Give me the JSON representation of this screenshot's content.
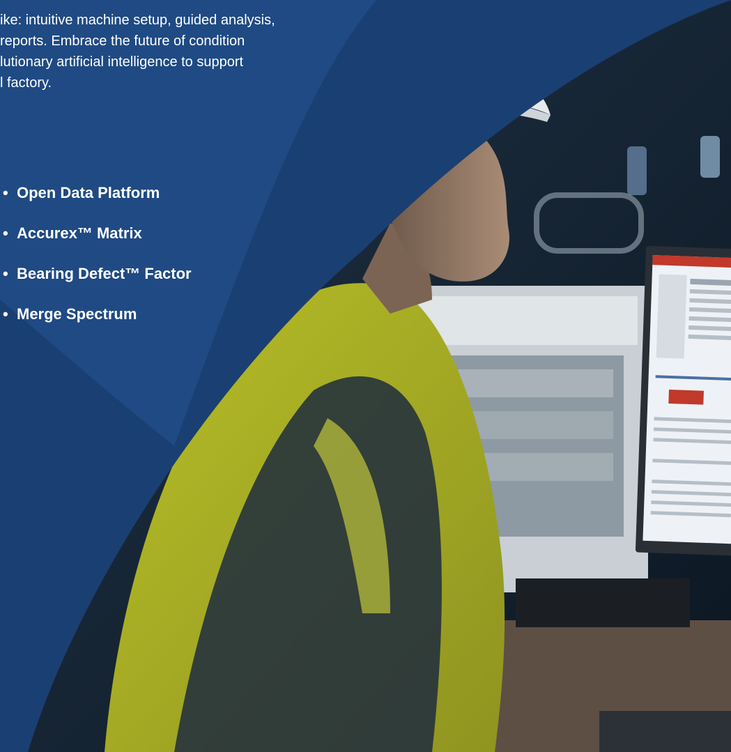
{
  "intro": {
    "text": "ike: intuitive machine setup, guided analysis,\n reports. Embrace the future of condition\nlutionary artificial intelligence to support\nl factory."
  },
  "features": [
    {
      "label": "Open Data Platform"
    },
    {
      "label": "Accurex™ Matrix"
    },
    {
      "label": "Bearing Defect™ Factor"
    },
    {
      "label": "Merge Spectrum"
    }
  ],
  "bullet_glyph": "•",
  "colors": {
    "navy": "#1a3f73",
    "navy_dark": "#143462",
    "photo_dark": "#0f1d2e",
    "hi_vis_yellow": "#c8cf2a",
    "monitor_screen": "#eef2f6"
  },
  "photo": {
    "subject": "worker in hard hat and hi-vis jacket at a computer monitor"
  }
}
